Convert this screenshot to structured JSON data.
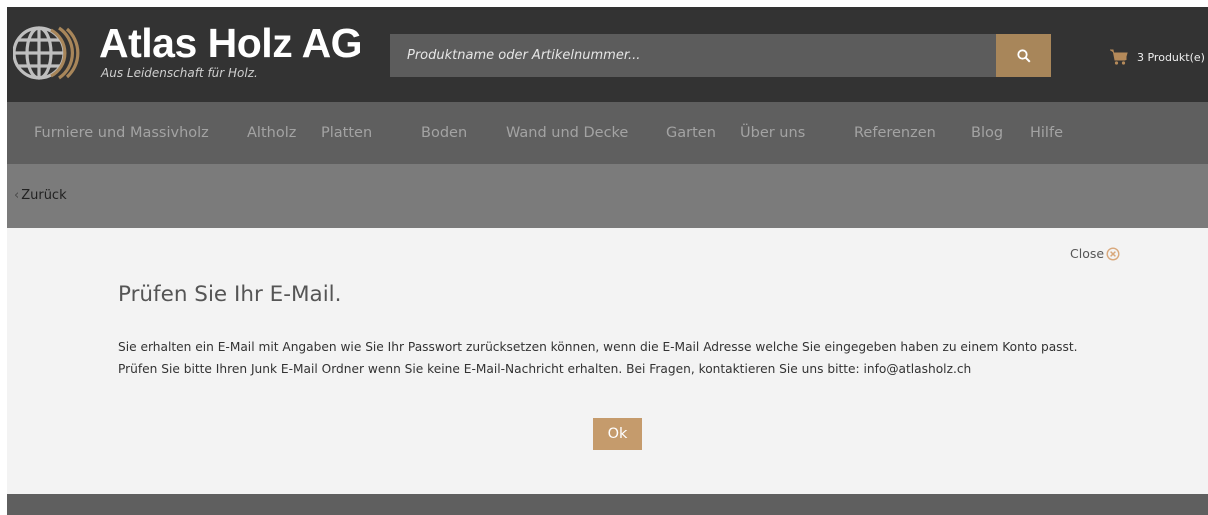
{
  "header": {
    "brand_name": "Atlas Holz AG",
    "tagline": "Aus Leidenschaft für Holz.",
    "search_placeholder": "Produktname oder Artikelnummer...",
    "search_icon": "search-icon",
    "cart_icon": "cart-icon",
    "cart_label": "3 Produkt(e)"
  },
  "nav": {
    "items": [
      {
        "label": "Furniere und Massivholz"
      },
      {
        "label": "Altholz"
      },
      {
        "label": "Platten"
      },
      {
        "label": "Boden"
      },
      {
        "label": "Wand und Decke"
      },
      {
        "label": "Garten"
      },
      {
        "label": "Über uns"
      },
      {
        "label": "Referenzen"
      },
      {
        "label": "Blog"
      },
      {
        "label": "Hilfe"
      }
    ]
  },
  "breadcrumb": {
    "chevron": "‹",
    "back_label": "Zurück"
  },
  "modal": {
    "close_label": "Close",
    "close_icon": "close-circle-icon",
    "title": "Prüfen Sie Ihr E-Mail.",
    "line1": "Sie erhalten ein E-Mail mit Angaben wie Sie Ihr Passwort zurücksetzen können, wenn die E-Mail Adresse welche Sie eingegeben haben zu einem Konto passt.",
    "line2": "Prüfen Sie bitte Ihren Junk E-Mail Ordner wenn Sie keine E-Mail-Nachricht erhalten. Bei Fragen, kontaktieren Sie uns bitte: info@atlasholz.ch",
    "ok_label": "Ok"
  },
  "colors": {
    "header_bg": "#333333",
    "nav_bg": "#5f5f5f",
    "crumb_bg": "#7b7b7b",
    "modal_bg": "#f3f3f3",
    "accent": "#c59b6c",
    "search_button": "#a8865a"
  }
}
